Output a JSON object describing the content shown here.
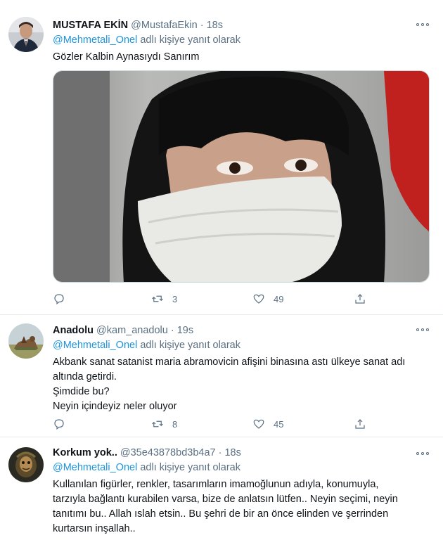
{
  "reply_prefix_suffix": "adlı kişiye yanıt olarak",
  "colors": {
    "link": "#1b95e0",
    "secondary": "#5b7083",
    "divider": "#e6ecf0"
  },
  "tweets": [
    {
      "name": "MUSTAFA EKİN",
      "handle": "@MustafaEkin",
      "time": "18s",
      "reply_to": "@Mehmetali_Onel",
      "lines": [
        "Gözler Kalbin Aynasıydı Sanırım"
      ],
      "retweets": "3",
      "likes": "49",
      "has_media": true
    },
    {
      "name": "Anadolu",
      "handle": "@kam_anadolu",
      "time": "19s",
      "reply_to": "@Mehmetali_Onel",
      "lines": [
        "Akbank sanat satanist maria abramovicin afişini binasına astı ülkeye sanat adı",
        "altında getirdi.",
        "Şimdide bu?",
        "Neyin içindeyiz neler oluyor"
      ],
      "retweets": "8",
      "likes": "45"
    },
    {
      "name": "Korkum yok..",
      "handle": "@35e43878bd3b4a7",
      "time": "18s",
      "reply_to": "@Mehmetali_Onel",
      "lines": [
        "Kullanılan figürler, renkler, tasarımların imamoğlunun adıyla, konumuyla,",
        "tarzıyla bağlantı kurabilen varsa, bize de anlatsın lütfen.. Neyin seçimi, neyin",
        "tanıtımı bu.. Allah ıslah etsin.. Bu şehri de bir an önce elinden ve şerrinden",
        "kurtarsın inşallah.."
      ]
    }
  ]
}
